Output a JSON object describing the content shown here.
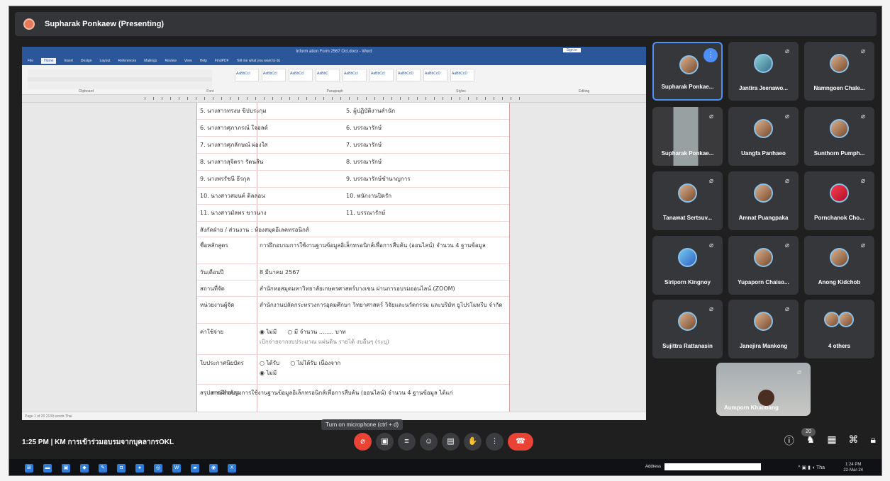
{
  "meeting": {
    "presenter_title": "Supharak Ponkaew (Presenting)",
    "time": "1:25 PM",
    "title": "KM การเข้าร่วมอบรมจากบุคลากรOKL",
    "mic_tooltip": "Turn on microphone (ctrl + d)",
    "participants_count": "20"
  },
  "word": {
    "window_title": "Inform ation Form 2567 Oct.docx - Word",
    "sign_in": "Sign in",
    "menu": [
      "File",
      "Home",
      "Insert",
      "Design",
      "Layout",
      "References",
      "Mailings",
      "Review",
      "View",
      "Help",
      "FindPDF",
      "Tell me what you want to do"
    ],
    "active_menu": "Home",
    "ribbon_labels": [
      "Clipboard",
      "Font",
      "Paragraph",
      "Styles",
      "Editing"
    ],
    "styles": [
      "AaBbCcI",
      "AaBbCcI",
      "AaBbCcI",
      "AaBbC",
      "AaBbCcI",
      "AaBbCcI",
      "AaBbCcD",
      "AaBbCcD",
      "AaBbCcD"
    ],
    "status": "Page 1 of 20   2139 words   Thai"
  },
  "document": {
    "rows": [
      {
        "c1": "5. นางสาวทรงษ ขิปบระกุม",
        "c2": "5. ผู้ปฏิบัติงานสำนัก"
      },
      {
        "c1": "6. นางสาวศุภาภรณ์ ใจอลด์",
        "c2": "6. บรรณารักษ์"
      },
      {
        "c1": "7. นางสาวศุภลักษณ์ ผ่องใส",
        "c2": "7. บรรณารักษ์"
      },
      {
        "c1": "8. นางสาวสุจิตรา รัตนสิน",
        "c2": "8. บรรณารักษ์"
      },
      {
        "c1": "9. นางพรรัชนี ธีรกุล",
        "c2": "9. บรรณารักษ์ชำนาญการ"
      },
      {
        "c1": "10. นางสาวสมนต์ ดิลลอน",
        "c2": "10. พนักงานปิดรัก"
      },
      {
        "c1": "11. นางสาวมัลพร ขาวนาง",
        "c2": "11. บรรณารักษ์"
      }
    ],
    "agency": "สังกัดฝ่าย / ส่วนงาน : ห้องสมุดอีเลคทรอนิกส์",
    "course_label": "ชื่อหลักสูตร",
    "course": "การฝึกอบรมการใช้งานฐานข้อมูลอิเล็กทรอนิกส์เพื่อการสืบค้น (ออนไลน์) จำนวน 4 ฐานข้อมูล",
    "date_label": "วันเดือนปี",
    "date": "8 มีนาคม 2567",
    "place_label": "สถานที่จัด",
    "place": "สำนักหอสมุดมหาวิทยาลัยเกษตรศาสตร์บางเขน ผ่านการอบรมออนไลน์ (ZOOM)",
    "organizer_label": "หน่วยงานผู้จัด",
    "organizer": "สำนักงานปลัดกระทรวงการอุดมศึกษา วิทยาศาสตร์ วิจัยและนวัตกรรม และบริษัท ยูโปรโมทรีบ จำกัด",
    "cost_label": "ค่าใช้จ่าย",
    "cost_options": [
      "ไม่มี",
      "มี จำนวน ........ บาท"
    ],
    "budget_note": "เบิกจ่ายจากงบประมาณ   แผ่นดิน   รายได้   งบอื่นๆ (ระบุ)",
    "certificate_label": "ใบประกาศนียบัตร",
    "certificate_options": [
      "ได้รับ",
      "ไม่ได้รับ เนื่องจาก"
    ],
    "summary_label": "สรุปสาระสำคัญ",
    "summary": "การฝึกอบรมการใช้งานฐานข้อมูลอิเล็กทรอนิกส์เพื่อการสืบค้น (ออนไลน์) จำนวน 4 ฐานข้อมูล ได้แก่"
  },
  "participants": [
    "Supharak Ponkae...",
    "Jantira Jeenawo...",
    "Namngoen Chale...",
    "Supharak Ponkae...",
    "Uangfa Panhaeo",
    "Sunthorn Pumph...",
    "Tanawat Sertsuv...",
    "Amnat Puangpaka",
    "Pornchanok Cho...",
    "Siriporn Kingnoy",
    "Yupaporn Chaiso...",
    "Anong Kidchob",
    "Sujittra Rattanasin",
    "Janejira Mankong",
    "4 others"
  ],
  "self_view": "Aumporn Khaobang",
  "taskbar": {
    "address": "Address",
    "time": "1:24 PM",
    "date": "22-Mar-24",
    "lang": "Tha"
  }
}
